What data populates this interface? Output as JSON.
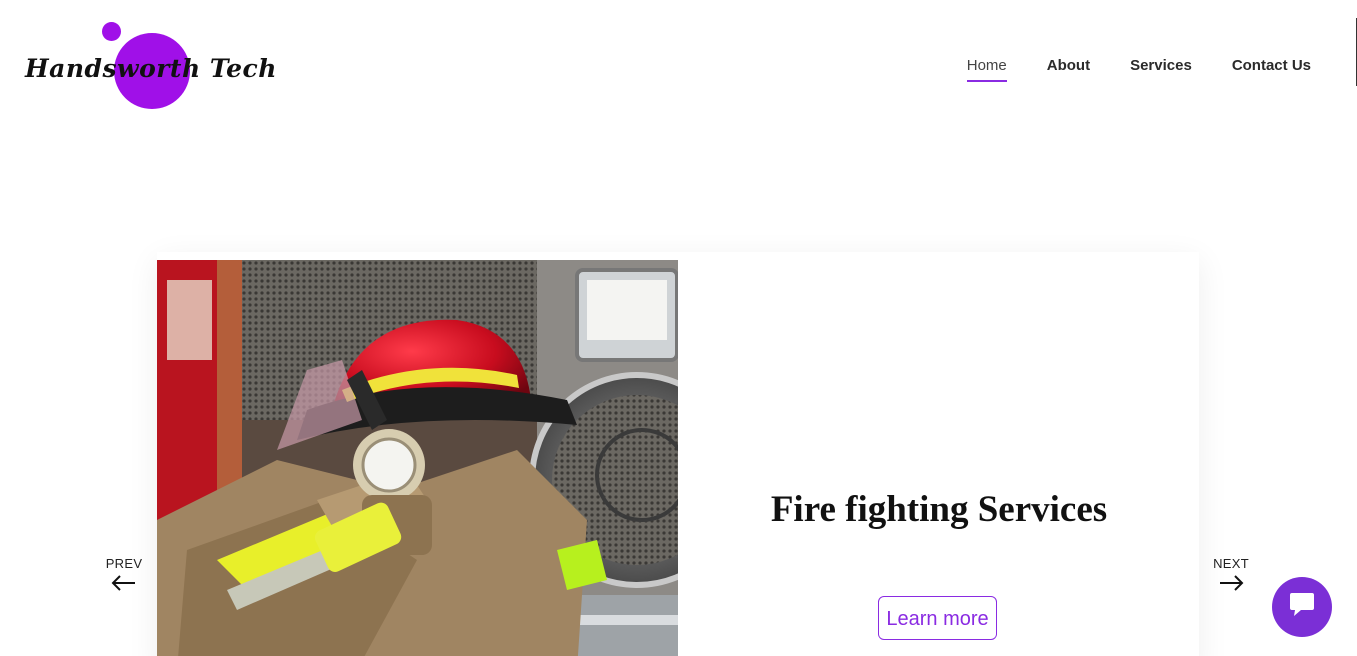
{
  "brand": {
    "name": "Handsworth Tech",
    "accent_color": "#a010e8"
  },
  "nav": {
    "items": [
      {
        "label": "Home",
        "active": true
      },
      {
        "label": "About",
        "active": false
      },
      {
        "label": "Services",
        "active": false
      },
      {
        "label": "Contact Us",
        "active": false
      }
    ]
  },
  "slider": {
    "slide": {
      "title": "Fire fighting Services",
      "button_label": "Learn more",
      "image_subject": "firefighter helmet and turnout gear on fire truck"
    },
    "prev_label": "PREV",
    "next_label": "NEXT"
  },
  "chat": {
    "icon": "chat-bubble-icon",
    "color": "#7b2fd6"
  }
}
